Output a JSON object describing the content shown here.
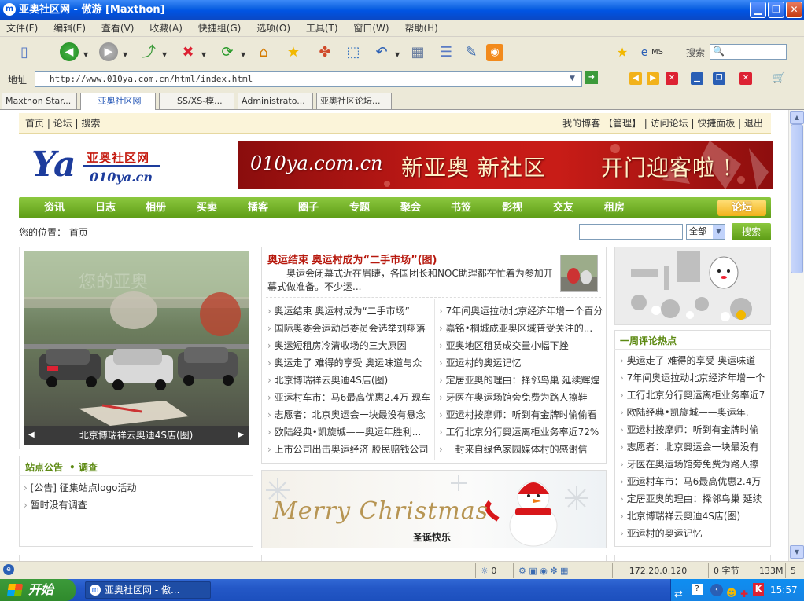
{
  "window": {
    "title": "亚奥社区网 - 傲游 [Maxthon]"
  },
  "menu": [
    "文件(F)",
    "编辑(E)",
    "查看(V)",
    "收藏(A)",
    "快捷组(G)",
    "选项(O)",
    "工具(T)",
    "窗口(W)",
    "帮助(H)"
  ],
  "toolbar": {
    "ms_label": "MS",
    "search_label": "搜索"
  },
  "address": {
    "label": "地址",
    "url": "http://www.010ya.com.cn/html/index.html"
  },
  "tabs": [
    "Maxthon Star...",
    "亚奥社区网",
    "SS/XS-模...",
    "Administrato...",
    "亚奥社区论坛..."
  ],
  "site": {
    "topnav_left": "首页 | 论坛 | 搜索",
    "topnav_right": "我的博客 【管理】 | 访问论坛 | 快捷面板 | 退出",
    "logo_ya": "Ya",
    "logo_cn": "亚奥社区网",
    "logo_domain": "010ya.cn",
    "banner_domain": "010ya.com.cn",
    "banner_slogan1": "新亚奥 新社区",
    "banner_slogan2": "开门迎客啦 !",
    "nav": [
      "资讯",
      "日志",
      "相册",
      "买卖",
      "播客",
      "圈子",
      "专题",
      "聚会",
      "书签",
      "影视",
      "交友",
      "租房"
    ],
    "nav_forum": "论坛",
    "location": "您的位置： 首页",
    "search_select": "全部",
    "search_button": "搜索",
    "photo_caption": "北京博瑞祥云奥迪4S店(图)",
    "photo_watermark": "您的亚奥",
    "headline": "奥运结束 奥运村成为“二手市场”(图)",
    "summary": "奥运会闭幕式近在眉睫，各国团长和NOC助理都在忙着为参加开幕式做准备。不少运...",
    "news_left": [
      "奥运结束 奥运村成为“二手市场”",
      "国际奥委会运动员委员会选举刘翔落",
      "奥运短租房冷清收场的三大原因",
      "奥运走了 难得的享受 奥运味道与众",
      "北京博瑞祥云奥迪4S店(图)",
      "亚运村车市：马6最高优惠2.4万 现车",
      "志愿者：北京奥运会一块最没有悬念",
      "欧陆经典•凯旋城——奥运年胜利...",
      "上市公司出击奥运经济 股民赔钱公司"
    ],
    "news_right": [
      "7年间奥运拉动北京经济年增一个百分",
      "嘉铭•桐城成亚奥区域普受关注的...",
      "亚奥地区租赁成交量小幅下挫",
      "亚运村的奥运记忆",
      "定居亚奥的理由：择邻鸟巢 延续辉煌",
      "牙医在奥运场馆旁免费为路人擦鞋",
      "亚运村按摩师：听到有金牌时偷偷看",
      "工行北京分行奥运离柜业务率近72%",
      "一封来自绿色家园媒体村的感谢信"
    ],
    "notice_title": "站点公告",
    "survey_title": "• 调查",
    "notices": [
      "[公告] 征集站点logo活动",
      "暂时没有调查"
    ],
    "xmas_text": "Merry Christmas",
    "xmas_cn": "圣诞快乐",
    "hot_title": "一周评论热点",
    "hot_list": [
      "奥运走了 难得的享受 奥运味道",
      "7年间奥运拉动北京经济年增一个",
      "工行北京分行奥运离柜业务率近7",
      "欧陆经典•凯旋城——奥运年.",
      "亚运村按摩师：听到有金牌时偷",
      "志愿者：北京奥运会一块最没有",
      "牙医在奥运场馆旁免费为路人擦",
      "亚运村车市：马6最高优惠2.4万",
      "定居亚奥的理由：择邻鸟巢 延续",
      "北京博瑞祥云奥迪4S店(图)",
      "亚运村的奥运记忆"
    ]
  },
  "status": {
    "count": "0",
    "ip": "172.20.0.120",
    "bytes": "0 字节",
    "mem": "133M",
    "num": "5"
  },
  "taskbar": {
    "start": "开始",
    "task": "亚奥社区网 - 傲...",
    "clock": "15:57"
  }
}
